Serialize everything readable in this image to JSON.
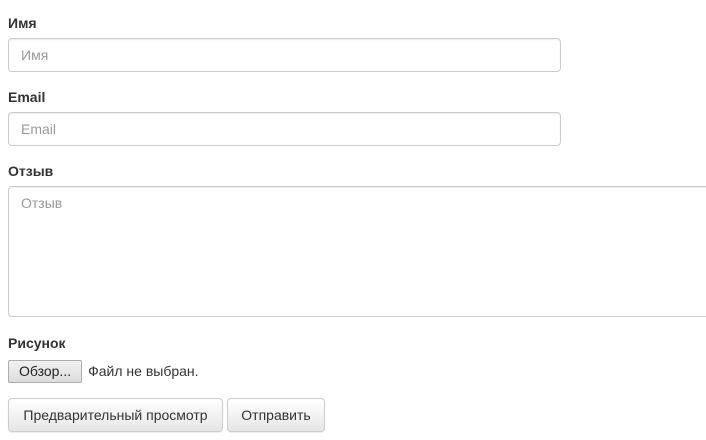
{
  "form": {
    "name": {
      "label": "Имя",
      "placeholder": "Имя",
      "value": ""
    },
    "email": {
      "label": "Email",
      "placeholder": "Email",
      "value": ""
    },
    "review": {
      "label": "Отзыв",
      "placeholder": "Отзыв",
      "value": ""
    },
    "image": {
      "label": "Рисунок",
      "browse_label": "Обзор...",
      "status": "Файл не выбран."
    },
    "buttons": {
      "preview": "Предварительный просмотр",
      "submit": "Отправить"
    }
  },
  "colors": {
    "label_text": "#333333",
    "placeholder": "#999999",
    "border": "#cccccc"
  }
}
